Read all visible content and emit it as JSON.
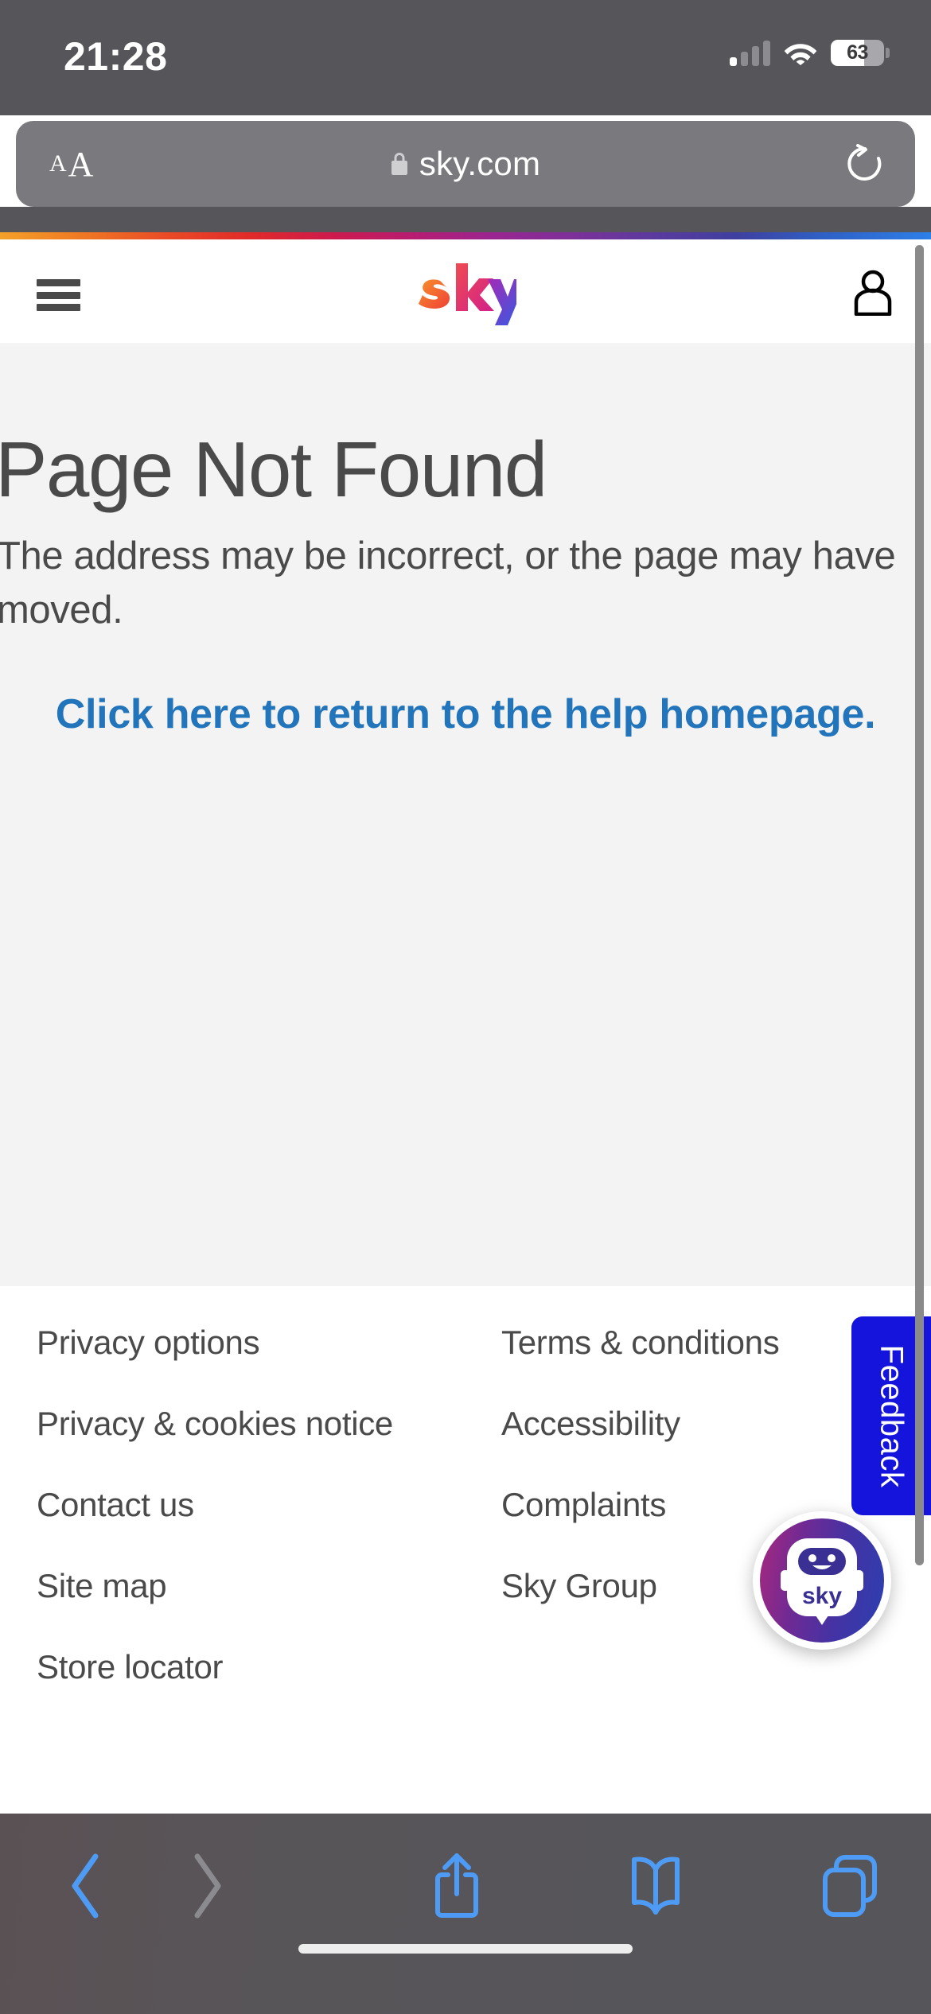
{
  "status_bar": {
    "time": "21:28",
    "signal_icon": "cellular-signal-icon",
    "signal_bars_filled": 1,
    "signal_bars_total": 4,
    "wifi_icon": "wifi-icon",
    "battery_percent": "63",
    "battery_level": 63
  },
  "browser": {
    "text_size_small": "A",
    "text_size_large": "A",
    "lock_icon": "lock-icon",
    "url": "sky.com",
    "reload_icon": "reload-icon",
    "toolbar": {
      "back_icon": "back-chevron-icon",
      "forward_icon": "forward-chevron-icon",
      "share_icon": "share-icon",
      "bookmarks_icon": "bookmarks-book-icon",
      "tabs_icon": "tabs-icon",
      "back_enabled": true,
      "forward_enabled": false
    }
  },
  "site_header": {
    "menu_icon": "hamburger-menu-icon",
    "logo": "sky-logo",
    "account_icon": "account-person-icon"
  },
  "main": {
    "title": "Page Not Found",
    "description": "The address may be incorrect, or the page may have moved.",
    "link_text": "Click here to return to the help homepage."
  },
  "footer": {
    "columns": [
      {
        "links": [
          "Privacy options",
          "Privacy & cookies notice",
          "Contact us",
          "Site map",
          "Store locator"
        ]
      },
      {
        "links": [
          "Terms & conditions",
          "Accessibility",
          "Complaints",
          "Sky Group"
        ]
      }
    ]
  },
  "feedback": {
    "label": "Feedback"
  },
  "chatbot": {
    "icon": "sky-chatbot-avatar-icon",
    "logo_text": "sky"
  },
  "colors": {
    "link_blue": "#2274bb",
    "feedback_blue": "#1414DC",
    "text_gray": "#4a4a4a",
    "content_bg": "#f3f3f3",
    "chrome_gray": "#55555a",
    "safari_blue": "#4e9bf5"
  }
}
